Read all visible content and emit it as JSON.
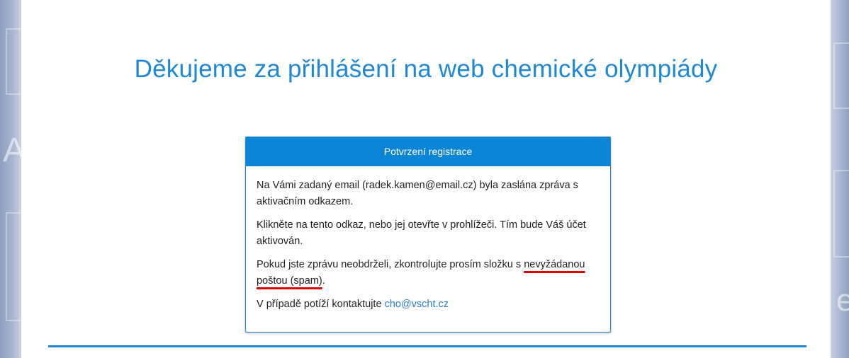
{
  "page": {
    "title": "Děkujeme za přihlášení na web chemické olympiády"
  },
  "panel": {
    "heading": "Potvrzení registrace",
    "p1": "Na Vámi zadaný email (radek.kamen@email.cz) byla zaslána zpráva s aktivačním odkazem.",
    "p2": "Klikněte na tento odkaz, nebo jej otevřte v prohlížeči. Tím bude Váš účet aktivován.",
    "p3_before": "Pokud jste zprávu neobdrželi, zkontrolujte prosím složku s ",
    "p3_highlight": "nevyžádanou poštou (spam)",
    "p3_after": ".",
    "p4_before": "V případě potíží kontaktujte ",
    "contact_email": "cho@vscht.cz"
  },
  "background": {
    "left_letter": "A",
    "right_letter": "e"
  },
  "colors": {
    "accent": "#1e88d6",
    "panel_header": "#0d85d6",
    "highlight_underline": "#e00000",
    "link": "#2a7fc9"
  }
}
